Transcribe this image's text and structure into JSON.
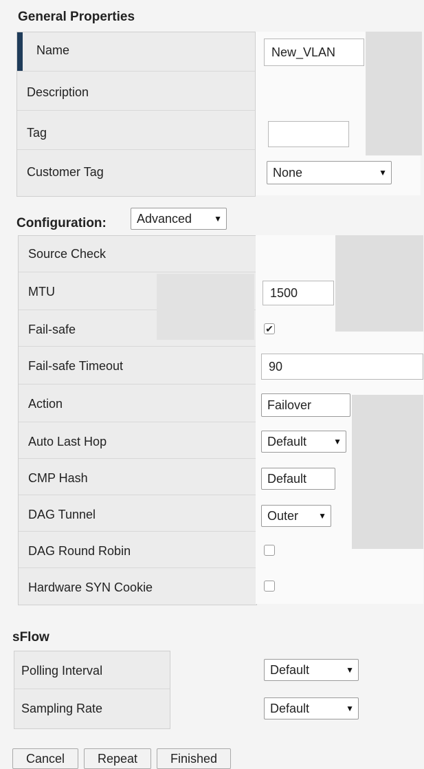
{
  "general": {
    "title": "General Properties",
    "name_label": "Name",
    "name_value": "New_VLAN",
    "description_label": "Description",
    "tag_label": "Tag",
    "tag_value": "",
    "customer_tag_label": "Customer Tag",
    "customer_tag_value": "None"
  },
  "configuration": {
    "title": "Configuration:",
    "mode_value": "Advanced",
    "source_check_label": "Source Check",
    "mtu_label": "MTU",
    "mtu_value": "1500",
    "failsafe_label": "Fail-safe",
    "failsafe_checked": true,
    "failsafe_timeout_label": "Fail-safe Timeout",
    "failsafe_timeout_value": "90",
    "action_label": "Action",
    "action_value": "Failover",
    "auto_last_hop_label": "Auto Last Hop",
    "auto_last_hop_value": "Default",
    "cmp_hash_label": "CMP Hash",
    "cmp_hash_value": "Default",
    "dag_tunnel_label": "DAG Tunnel",
    "dag_tunnel_value": "Outer",
    "dag_round_robin_label": "DAG Round Robin",
    "dag_round_robin_checked": false,
    "hw_syn_cookie_label": "Hardware SYN Cookie",
    "hw_syn_cookie_checked": false
  },
  "sflow": {
    "title": "sFlow",
    "polling_interval_label": "Polling Interval",
    "polling_interval_value": "Default",
    "sampling_rate_label": "Sampling Rate",
    "sampling_rate_value": "Default"
  },
  "buttons": {
    "cancel": "Cancel",
    "repeat": "Repeat",
    "finished": "Finished"
  },
  "icons": {
    "dropdown_arrow": "▼",
    "check_mark": "✔"
  }
}
